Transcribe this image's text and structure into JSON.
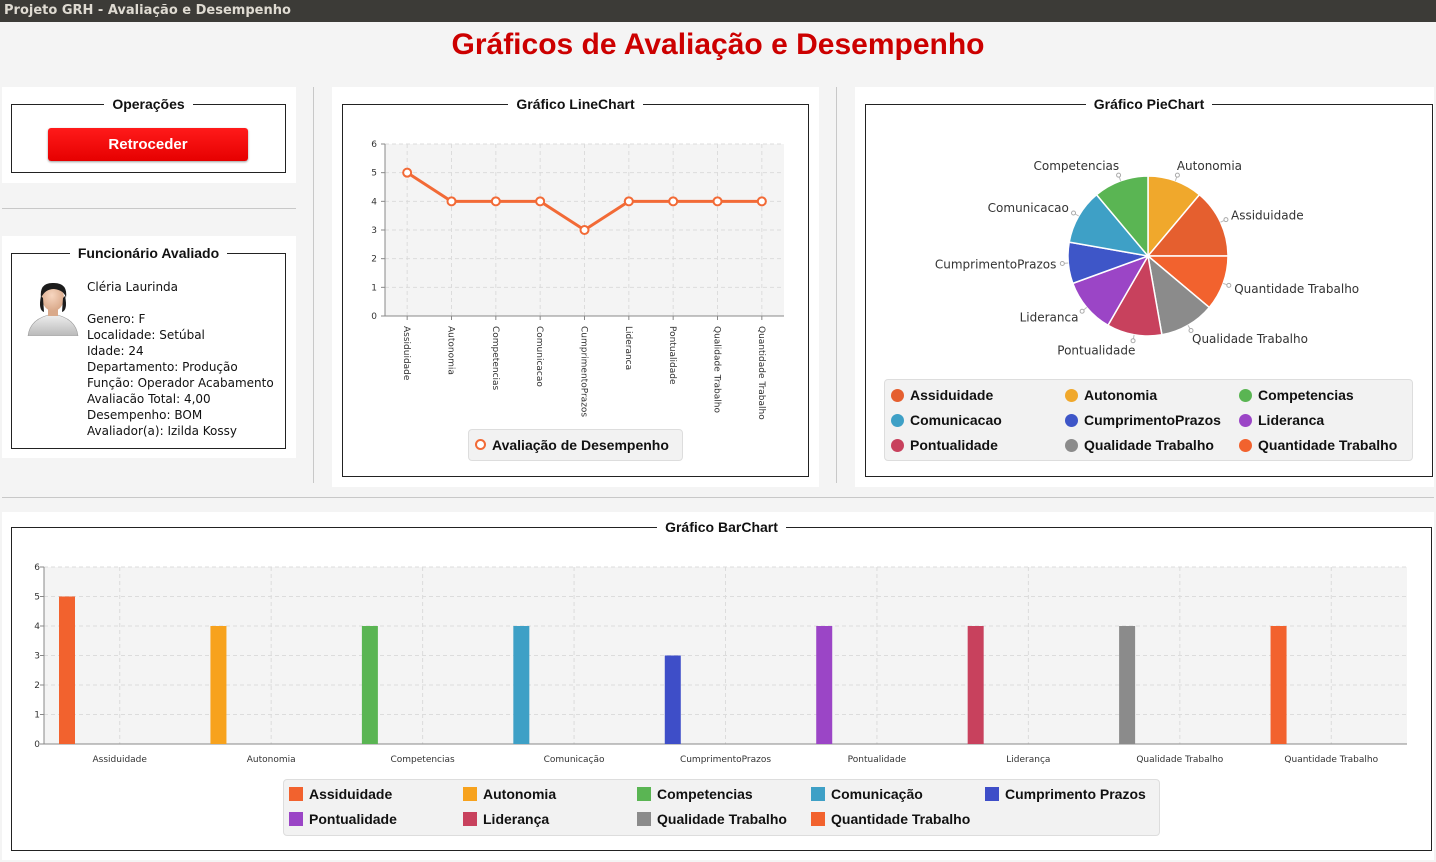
{
  "window": {
    "title": "Projeto GRH - Avaliação e Desempenho"
  },
  "header": {
    "title": "Gráficos de Avaliação e Desempenho",
    "title_color": "#cc0000"
  },
  "operations": {
    "title": "Operações",
    "back_button": "Retroceder"
  },
  "employee": {
    "title": "Funcionário Avaliado",
    "avatar_icon": "user-avatar-icon",
    "name": "Cléria Laurinda",
    "genero": "Genero: F",
    "localidade": "Localidade: Setúbal",
    "idade": "Idade: 24",
    "departamento": "Departamento: Produção",
    "funcao": "Função: Operador Acabamento",
    "avaliacao": "Avaliacão Total: 4,00",
    "desempenho": "Desempenho: BOM",
    "avaliador": "Avaliador(a): Izilda Kossy"
  },
  "line_panel": {
    "title": "Gráfico LineChart"
  },
  "pie_panel": {
    "title": "Gráfico PieChart"
  },
  "bar_panel": {
    "title": "Gráfico BarChart"
  },
  "chart_data": [
    {
      "type": "line",
      "categories": [
        "Assiduidade",
        "Autonomia",
        "Competencias",
        "Comunicacao",
        "CumprimentoPrazos",
        "Lideranca",
        "Pontualidade",
        "Qualidade Trabalho",
        "Quantidade Trabalho"
      ],
      "series": [
        {
          "name": "Avaliação de Desempenho",
          "values": [
            5,
            4,
            4,
            4,
            3,
            4,
            4,
            4,
            4
          ],
          "color": "#f26a36"
        }
      ],
      "ylim": [
        0,
        6
      ],
      "yticks": [
        "0",
        "1",
        "2",
        "3",
        "4",
        "5",
        "6"
      ],
      "grid": true,
      "legend": "bottom"
    },
    {
      "type": "pie",
      "labels": [
        "Autonomia",
        "Assiduidade",
        "Quantidade Trabalho",
        "Qualidade Trabalho",
        "Pontualidade",
        "Lideranca",
        "CumprimentoPrazos",
        "Comunicacao",
        "Competencias"
      ],
      "values": [
        4,
        5,
        4,
        4,
        4,
        4,
        3,
        4,
        4
      ],
      "colors": [
        "#f0a82c",
        "#e55f2f",
        "#f2622e",
        "#8b8b8b",
        "#c8415d",
        "#9b45c6",
        "#3e56c8",
        "#3ea0c6",
        "#5ab553"
      ],
      "legend_items": [
        {
          "label": "Assiduidade",
          "color": "#e55f2f"
        },
        {
          "label": "Autonomia",
          "color": "#f0a82c"
        },
        {
          "label": "Competencias",
          "color": "#5ab553"
        },
        {
          "label": "Comunicacao",
          "color": "#3ea0c6"
        },
        {
          "label": "CumprimentoPrazos",
          "color": "#3e56c8"
        },
        {
          "label": "Lideranca",
          "color": "#9b45c6"
        },
        {
          "label": "Pontualidade",
          "color": "#c8415d"
        },
        {
          "label": "Qualidade Trabalho",
          "color": "#8b8b8b"
        },
        {
          "label": "Quantidade Trabalho",
          "color": "#f2622e"
        }
      ],
      "legend": "bottom"
    },
    {
      "type": "bar",
      "categories": [
        "Assiduidade",
        "Autonomia",
        "Competencias",
        "Comunicação",
        "CumprimentoPrazos",
        "Pontualidade",
        "Liderança",
        "Qualidade Trabalho",
        "Quantidade Trabalho"
      ],
      "series": [
        {
          "name": "Assiduidade",
          "values": [
            5,
            null,
            null,
            null,
            null,
            null,
            null,
            null,
            null
          ],
          "color": "#f2622e"
        },
        {
          "name": "Autonomia",
          "values": [
            null,
            4,
            null,
            null,
            null,
            null,
            null,
            null,
            null
          ],
          "color": "#f7a21d"
        },
        {
          "name": "Competencias",
          "values": [
            null,
            null,
            4,
            null,
            null,
            null,
            null,
            null,
            null
          ],
          "color": "#5ab553"
        },
        {
          "name": "Comunicação",
          "values": [
            null,
            null,
            null,
            4,
            null,
            null,
            null,
            null,
            null
          ],
          "color": "#3ea0c6"
        },
        {
          "name": "Cumprimento Prazos",
          "values": [
            null,
            null,
            null,
            null,
            3,
            null,
            null,
            null,
            null
          ],
          "color": "#3e4ec8"
        },
        {
          "name": "Pontualidade",
          "values": [
            null,
            null,
            null,
            null,
            null,
            4,
            null,
            null,
            null
          ],
          "color": "#9b45c6"
        },
        {
          "name": "Liderança",
          "values": [
            null,
            null,
            null,
            null,
            null,
            null,
            4,
            null,
            null
          ],
          "color": "#c8415d"
        },
        {
          "name": "Qualidade Trabalho",
          "values": [
            null,
            null,
            null,
            null,
            null,
            null,
            null,
            4,
            null
          ],
          "color": "#8b8b8b"
        },
        {
          "name": "Quantidade Trabalho",
          "values": [
            null,
            null,
            null,
            null,
            null,
            null,
            null,
            null,
            4
          ],
          "color": "#f2622e"
        }
      ],
      "ylim": [
        0,
        6
      ],
      "yticks": [
        "0",
        "1",
        "2",
        "3",
        "4",
        "5",
        "6"
      ],
      "grid": true,
      "legend": "bottom"
    }
  ]
}
